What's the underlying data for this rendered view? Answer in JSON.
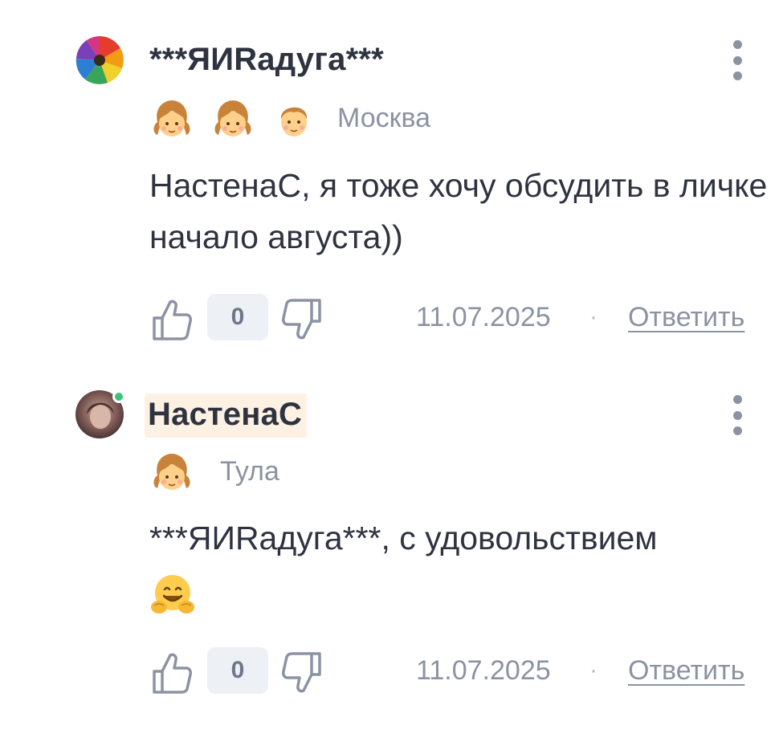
{
  "comments": [
    {
      "username": "***ЯИRадуга***",
      "city": "Москва",
      "text": "НастенаС, я тоже хочу обсудить в личке начало августа))",
      "score": "0",
      "date": "11.07.2025",
      "reply_label": "Ответить",
      "separator": "·",
      "badges": [
        "girl-icon",
        "girl-icon",
        "boy-icon"
      ],
      "online": false
    },
    {
      "username": "НастенаС",
      "city": "Тула",
      "text": "***ЯИRадуга***, с удовольствием",
      "score": "0",
      "date": "11.07.2025",
      "reply_label": "Ответить",
      "separator": "·",
      "badges": [
        "girl-icon"
      ],
      "online": true,
      "emoji": "hugging-face-icon"
    }
  ],
  "colors": {
    "text": "#2e3340",
    "muted": "#8b93a3",
    "score_bg": "#edf1f6",
    "highlight_bg": "#fdf1e3",
    "online": "#3cc37a"
  }
}
